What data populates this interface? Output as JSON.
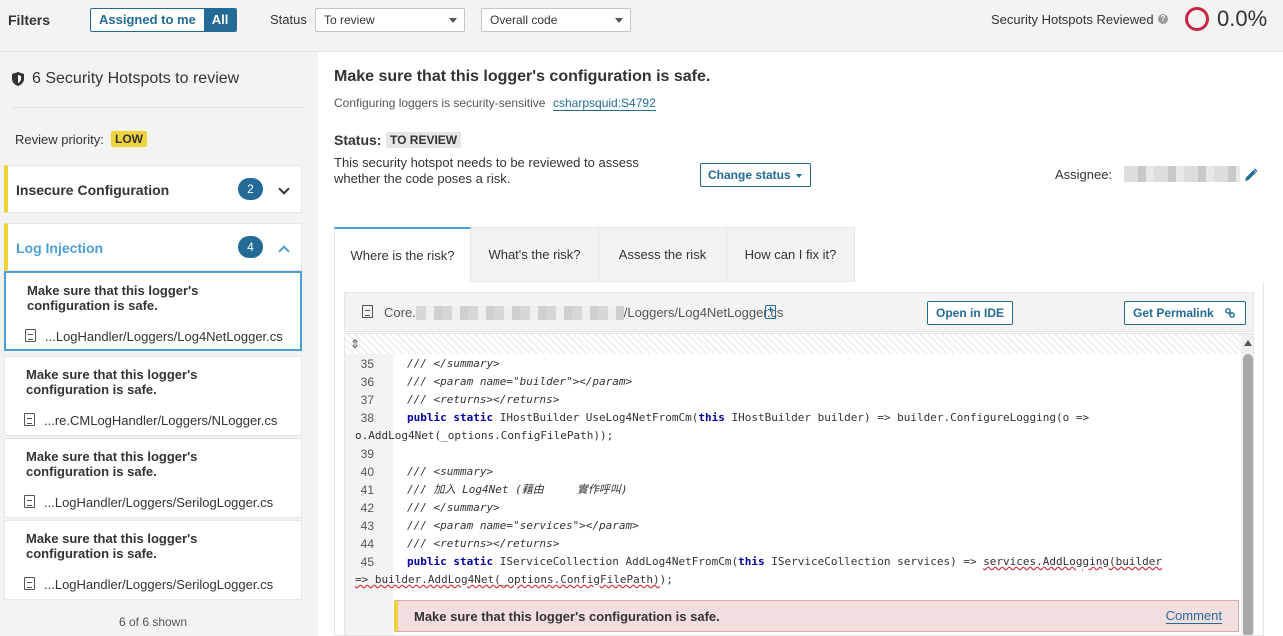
{
  "filters": {
    "title": "Filters",
    "assigned_to_me": "Assigned to me",
    "all": "All",
    "status_label": "Status",
    "status_value": "To review",
    "scope_value": "Overall code",
    "reviewed_label": "Security Hotspots Reviewed",
    "reviewed_pct": "0.0%",
    "reviewed_ring_color": "#c6283f"
  },
  "sidebar": {
    "header": "6 Security Hotspots to review",
    "priority_label": "Review priority:",
    "priority_value": "LOW",
    "categories": [
      {
        "title": "Insecure Configuration",
        "count": "2",
        "expanded": false
      },
      {
        "title": "Log Injection",
        "count": "4",
        "expanded": true
      }
    ],
    "hotspots": [
      {
        "message": "Make sure that this logger's configuration is safe.",
        "path": "...LogHandler/Loggers/Log4NetLogger.cs",
        "selected": true
      },
      {
        "message": "Make sure that this logger's configuration is safe.",
        "path": "...re.CMLogHandler/Loggers/NLogger.cs",
        "selected": false
      },
      {
        "message": "Make sure that this logger's configuration is safe.",
        "path": "...LogHandler/Loggers/SerilogLogger.cs",
        "selected": false
      },
      {
        "message": "Make sure that this logger's configuration is safe.",
        "path": "...LogHandler/Loggers/SerilogLogger.cs",
        "selected": false
      }
    ],
    "shown": "6 of 6 shown"
  },
  "main": {
    "title": "Make sure that this logger's configuration is safe.",
    "subtitle": "Configuring loggers is security-sensitive",
    "rule": "csharpsquid:S4792",
    "status_label": "Status:",
    "status_value": "TO REVIEW",
    "status_desc": "This security hotspot needs to be reviewed to assess whether the code poses a risk.",
    "change_status": "Change status",
    "assignee_label": "Assignee:",
    "tabs": [
      "Where is the risk?",
      "What's the risk?",
      "Assess the risk",
      "How can I fix it?"
    ],
    "file_prefix": "Core.",
    "file_suffix": "/Loggers/Log4NetLogger.cs",
    "open_in_ide": "Open in IDE",
    "get_permalink": "Get Permalink",
    "issue_message": "Make sure that this logger's configuration is safe.",
    "comment": "Comment",
    "code": [
      {
        "num": "35",
        "text": "/// </summary>"
      },
      {
        "num": "36",
        "text": "/// <param name=\"builder\"></param>"
      },
      {
        "num": "37",
        "text": "/// <returns></returns>"
      },
      {
        "num": "38",
        "kw1": "public static ",
        "rest1": "IHostBuilder UseLog4NetFromCm(",
        "kw2": "this ",
        "rest2": "IHostBuilder builder) => builder.ConfigureLogging(o =>"
      },
      {
        "num": "",
        "text": "o.AddLog4Net(_options.ConfigFilePath));"
      },
      {
        "num": "39",
        "text": ""
      },
      {
        "num": "40",
        "text": "/// <summary>"
      },
      {
        "num": "41",
        "text": "/// 加入 Log4Net (藉由     實作呼叫)"
      },
      {
        "num": "42",
        "text": "/// </summary>"
      },
      {
        "num": "43",
        "text": "/// <param name=\"services\"></param>"
      },
      {
        "num": "44",
        "text": "/// <returns></returns>"
      },
      {
        "num": "45",
        "kw1": "public static ",
        "rest1": "IServiceCollection AddLog4NetFromCm(",
        "kw2": "this ",
        "rest2": "IServiceCollection services) => ",
        "sq": "services.AddLogging(builder"
      },
      {
        "num": "",
        "sq": "=> builder.AddLog4Net(_options.ConfigFilePath)",
        "tail": ");"
      }
    ]
  }
}
